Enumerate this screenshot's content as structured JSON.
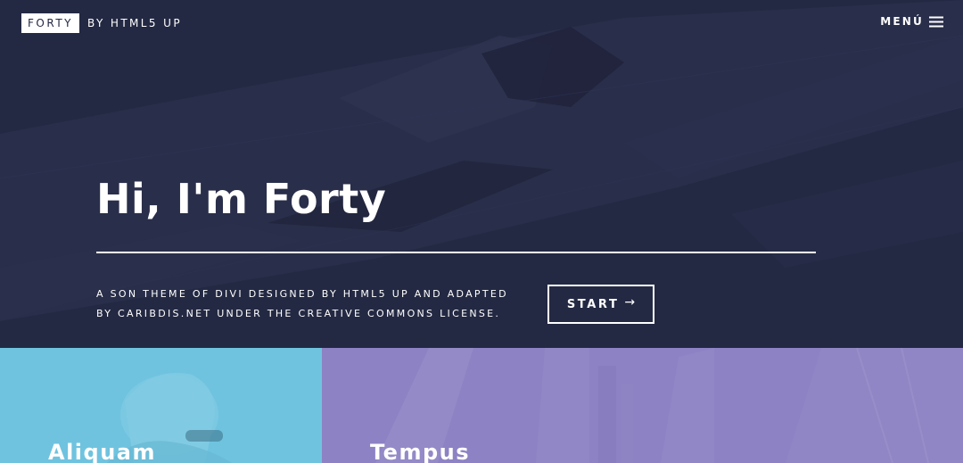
{
  "header": {
    "logo_box": "FORTY",
    "logo_rest": "BY HTML5 UP",
    "menu_label": "MENÚ",
    "menu_icon": "hamburger-icon"
  },
  "hero": {
    "title": "Hi, I'm Forty",
    "description_line1": "A SON THEME OF DIVI DESIGNED BY HTML5 UP AND ADAPTED",
    "description_line2": "BY CARIBDIS.NET UNDER THE CREATIVE COMMONS LICENSE.",
    "button_label": "START",
    "button_icon": "arrow-right-icon",
    "arrow_glyph": "→"
  },
  "tiles": [
    {
      "title": "Aliquam",
      "color": "#6fc3df"
    },
    {
      "title": "Tempus",
      "color": "#8d82c4"
    }
  ],
  "colors": {
    "hero_background": "#242943",
    "text": "#ffffff"
  }
}
